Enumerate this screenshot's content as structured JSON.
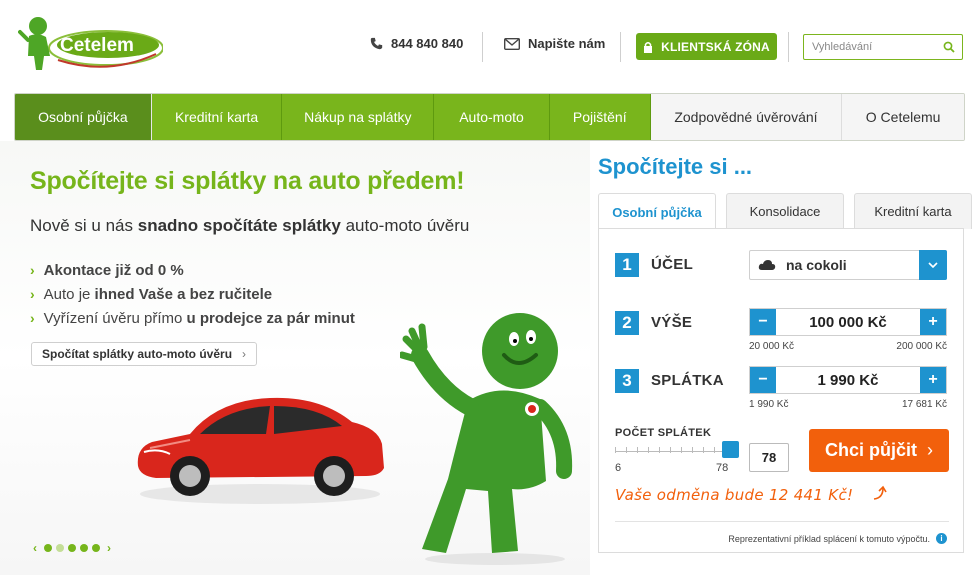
{
  "header": {
    "logo_text": "Cetelem",
    "phone": "844 840 840",
    "mail_label": "Napište nám",
    "client_zone": "KLIENTSKÁ ZÓNA",
    "search_placeholder": "Vyhledávání"
  },
  "nav": [
    {
      "label": "Osobní půjčka",
      "style": "active"
    },
    {
      "label": "Kreditní karta",
      "style": "green"
    },
    {
      "label": "Nákup na splátky",
      "style": "green"
    },
    {
      "label": "Auto-moto",
      "style": "green"
    },
    {
      "label": "Pojištění",
      "style": "green"
    },
    {
      "label": "Zodpovědné úvěrování",
      "style": "grey"
    },
    {
      "label": "O Cetelemu",
      "style": "grey"
    }
  ],
  "hero": {
    "title": "Spočítejte si splátky na auto předem!",
    "subtitle_pre": "Nově si u nás ",
    "subtitle_bold": "snadno spočítáte splátky",
    "subtitle_post": " auto-moto úvěru",
    "bullets": [
      {
        "pre": "",
        "bold": "Akontace již od 0 %",
        "mid": "",
        "bold2": "",
        "post": ""
      },
      {
        "pre": "Auto je ",
        "bold": "ihned Vaše a bez ručitele",
        "mid": "",
        "bold2": "",
        "post": ""
      },
      {
        "pre": "Vyřízení úvěru přímo ",
        "bold": "u prodejce za pár minut",
        "mid": "",
        "bold2": "",
        "post": ""
      }
    ],
    "cta_label": "Spočítat splátky auto-moto úvěru",
    "carousel_active_index": 1,
    "carousel_count": 5
  },
  "calc": {
    "title": "Spočítejte si ...",
    "tabs": [
      "Osobní půjčka",
      "Konsolidace",
      "Kreditní karta"
    ],
    "active_tab": 0,
    "steps": {
      "ucel": {
        "num": "1",
        "label": "ÚČEL",
        "value": "na cokoli"
      },
      "vyse": {
        "num": "2",
        "label": "VÝŠE",
        "value": "100 000 Kč",
        "min": "20 000 Kč",
        "max": "200 000 Kč"
      },
      "splatka": {
        "num": "3",
        "label": "SPLÁTKA",
        "value": "1 990 Kč",
        "min": "1 990 Kč",
        "max": "17 681 Kč"
      }
    },
    "pocet": {
      "label": "POČET SPLÁTEK",
      "min": "6",
      "max": "78",
      "value": "78",
      "fraction": 1.0
    },
    "submit_label": "Chci půjčit",
    "reward": "Vaše odměna bude 12 441 Kč!",
    "example": "Reprezentativní příklad splácení k tomuto výpočtu."
  },
  "colors": {
    "green": "#79b51c",
    "blue": "#1e93cf",
    "orange": "#f2600c"
  }
}
